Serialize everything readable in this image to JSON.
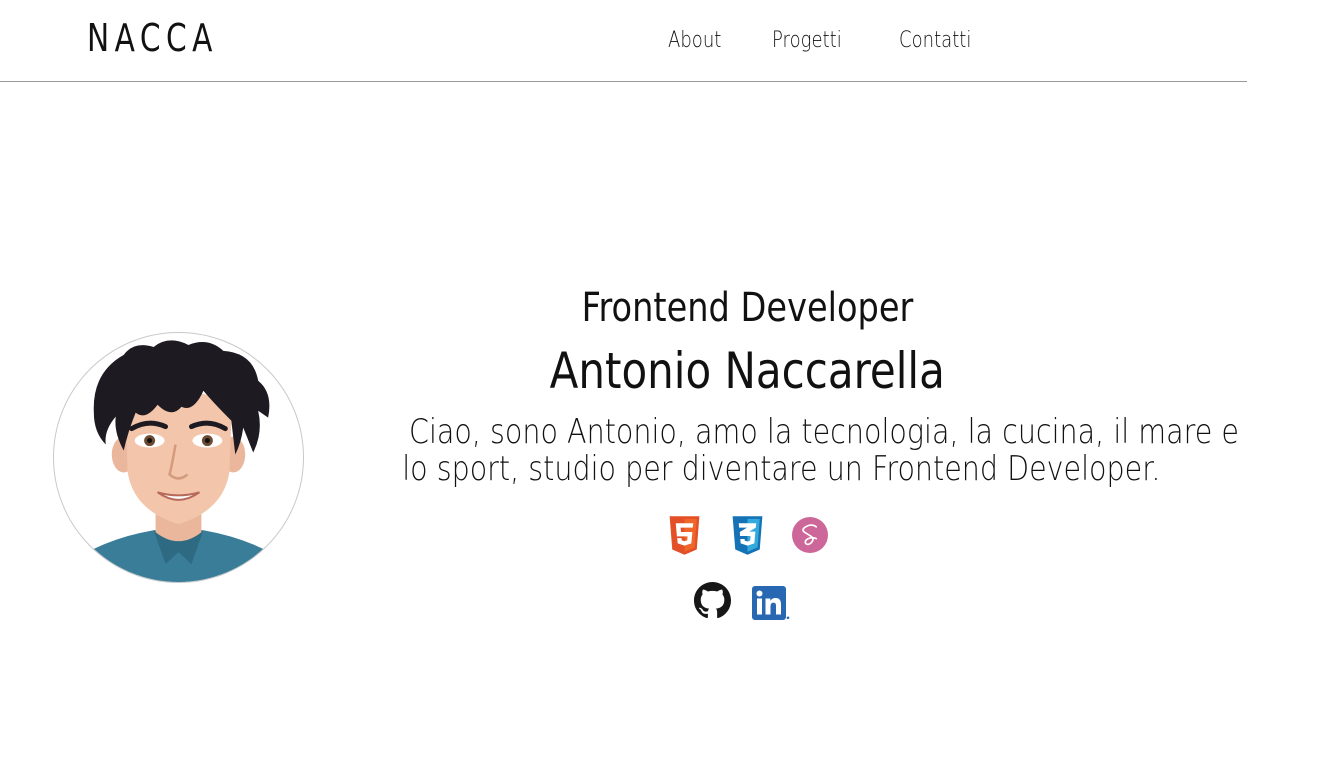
{
  "header": {
    "logo": "NACCA",
    "nav": [
      {
        "label": "About"
      },
      {
        "label": "Progetti"
      },
      {
        "label": "Contatti"
      }
    ]
  },
  "hero": {
    "role": "Frontend Developer",
    "name": "Antonio Naccarella",
    "bio_lines": [
      "Ciao, sono Antonio, amo la tecnologia, la cucina, il mare e",
      "lo sport, studio per diventare un Frontend Developer."
    ]
  },
  "skills": [
    {
      "icon": "html5-icon",
      "color": "#e34f26"
    },
    {
      "icon": "css3-icon",
      "color": "#1572b6"
    },
    {
      "icon": "sass-icon",
      "color": "#cd6799"
    }
  ],
  "social": [
    {
      "icon": "github-icon",
      "color": "#181717"
    },
    {
      "icon": "linkedin-icon",
      "color": "#2867b2"
    }
  ],
  "colors": {
    "text": "#111111",
    "background": "#ffffff",
    "divider": "#9a9a9a"
  }
}
